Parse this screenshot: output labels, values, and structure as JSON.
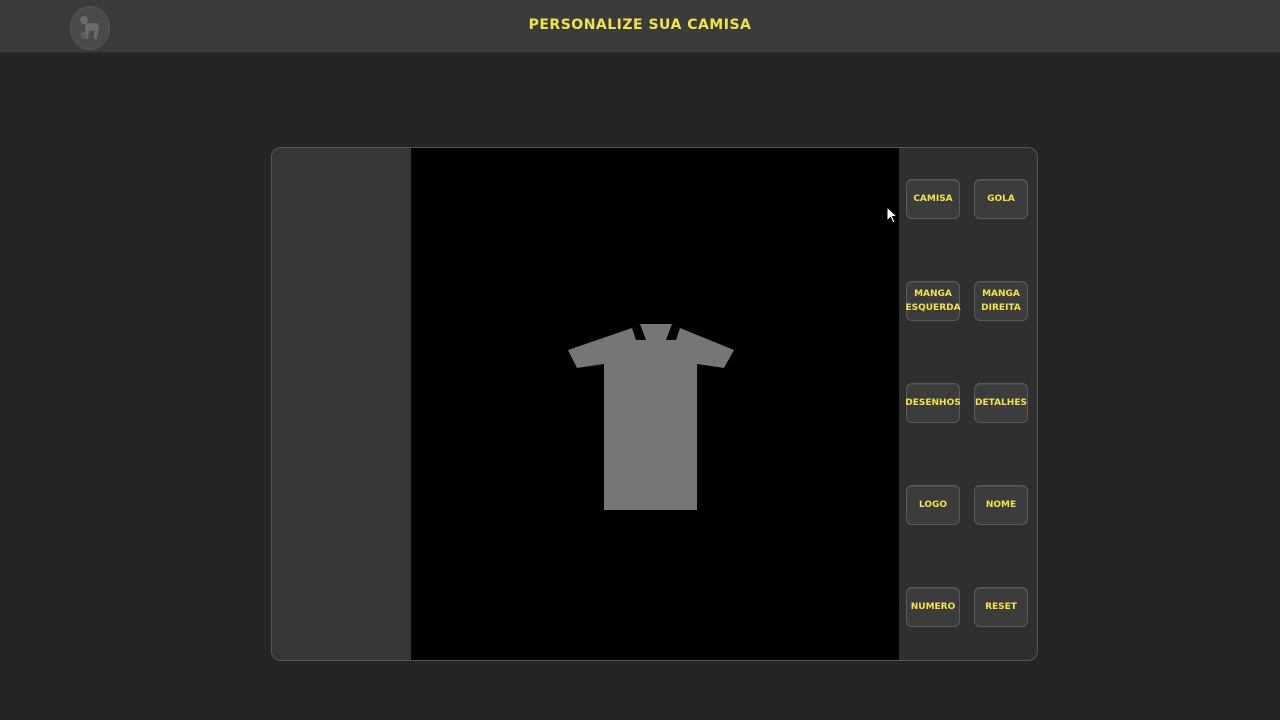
{
  "header": {
    "title": "PERSONALIZE SUA CAMISA",
    "logo_icon": "dog-logo-icon"
  },
  "colors": {
    "accent_text": "#f2e34b",
    "shirt_fill": "#767676",
    "canvas_bg": "#000000"
  },
  "buttons": {
    "camisa": "CAMISA",
    "gola": "GOLA",
    "manga_esquerda": "MANGA\nESQUERDA",
    "manga_direita": "MANGA\nDIREITA",
    "desenhos": "DESENHOS",
    "detalhes": "DETALHES",
    "logo": "LOGO",
    "nome": "NOME",
    "numero": "NUMERO",
    "reset": "RESET"
  }
}
